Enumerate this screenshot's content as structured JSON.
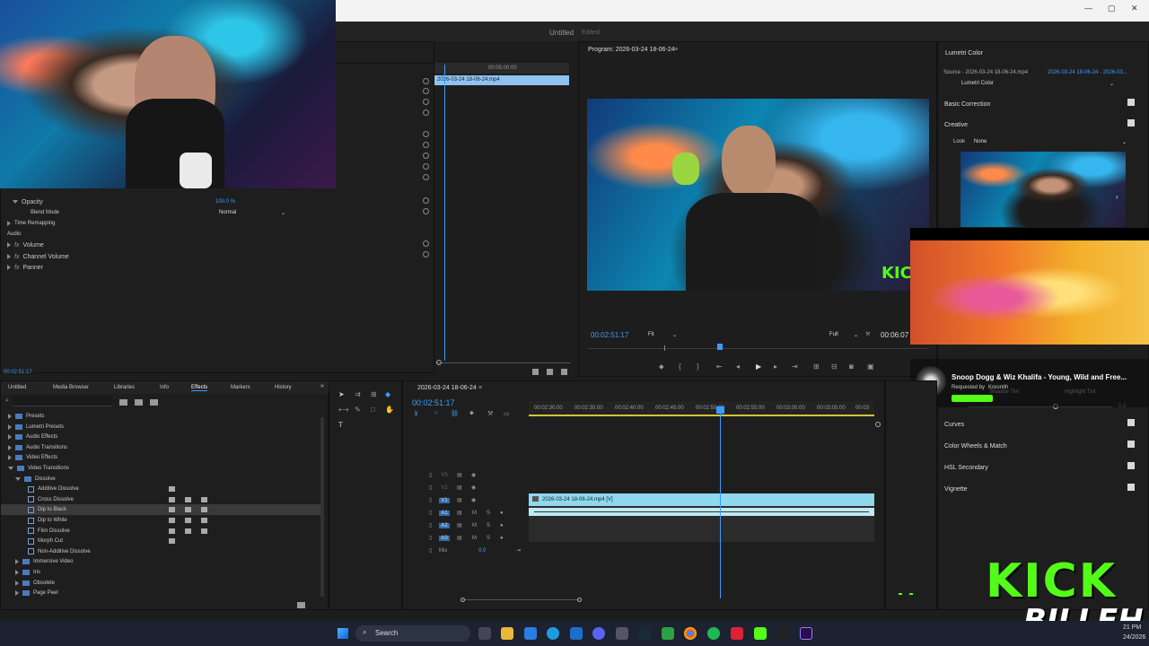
{
  "window": {
    "title": "Untitled",
    "status": "Edited"
  },
  "source_timeline": {
    "timecode": "00:05:00:00",
    "clip_name": "2026-03-24 18-06-24.mp4"
  },
  "effect_controls": {
    "rows": [
      {
        "label": "Opacity",
        "value": "100.0 %"
      },
      {
        "label": "Blend Mode",
        "value": "Normal"
      },
      {
        "label": "Time Remapping"
      },
      {
        "label": "Audio"
      },
      {
        "label": "Volume"
      },
      {
        "label": "Channel Volume"
      },
      {
        "label": "Panner"
      }
    ],
    "timecode": "00:02:51:17"
  },
  "program_monitor": {
    "title": "Program: 2026-03-24 18-06-24",
    "timecode": "00:02:51:17",
    "fit": "Fit",
    "quality": "Full",
    "duration": "00:06:07"
  },
  "lumetri": {
    "title": "Lumetri Color",
    "source": "Source - 2026-03-24 18-06-24.mp4",
    "source_link": "2026-03-24 18-06-24 - 2026-03...",
    "effect": "Lumetri Color",
    "sections": [
      "Basic Correction",
      "Creative"
    ],
    "look_label": "Look",
    "look_value": "None",
    "more_sections": [
      "Curves",
      "Color Wheels & Match",
      "HSL Secondary",
      "Vignette"
    ],
    "slider_value": "0.0"
  },
  "now_playing": {
    "song": "Snoop Dogg & Wiz Khalifa - Young, Wild and Free...",
    "requested_prefix": "Requested by",
    "requested_by": "Kreonith",
    "ghost_labels": [
      "Shadow Tint",
      "Highlight Tint"
    ]
  },
  "project_panel": {
    "tabs": [
      "Untitled",
      "Media Browser",
      "Libraries",
      "Info",
      "Effects",
      "Markers",
      "History"
    ],
    "active_tab": "Effects",
    "tree": [
      {
        "label": "Presets",
        "level": 0
      },
      {
        "label": "Lumetri Presets",
        "level": 0
      },
      {
        "label": "Audio Effects",
        "level": 0
      },
      {
        "label": "Audio Transitions",
        "level": 0
      },
      {
        "label": "Video Effects",
        "level": 0
      },
      {
        "label": "Video Transitions",
        "level": 0,
        "open": true
      },
      {
        "label": "Dissolve",
        "level": 1,
        "open": true
      },
      {
        "label": "Additive Dissolve",
        "level": 2
      },
      {
        "label": "Cross Dissolve",
        "level": 2
      },
      {
        "label": "Dip to Black",
        "level": 2,
        "selected": true
      },
      {
        "label": "Dip to White",
        "level": 2
      },
      {
        "label": "Film Dissolve",
        "level": 2
      },
      {
        "label": "Morph Cut",
        "level": 2
      },
      {
        "label": "Non-Additive Dissolve",
        "level": 2
      },
      {
        "label": "Immersive Video",
        "level": 1
      },
      {
        "label": "Iris",
        "level": 1
      },
      {
        "label": "Obsolete",
        "level": 1
      },
      {
        "label": "Page Peel",
        "level": 1
      }
    ]
  },
  "timeline": {
    "sequence": "2026-03-24 18-06-24",
    "timecode": "00:02:51:17",
    "ruler": [
      "00:02:30:00",
      "00:02:35:00",
      "00:02:40:00",
      "00:02:45:00",
      "00:02:50:00",
      "00:02:55:00",
      "00:03:00:00",
      "00:03:05:00",
      "00:03"
    ],
    "tracks": [
      "V3",
      "V2",
      "V1",
      "A1",
      "A2",
      "A3"
    ],
    "mix_label": "Mix",
    "mix_value": "0.0",
    "clip_label": "2026-03-24 18-06-24.mp4 [V]"
  },
  "overlay": {
    "brand_top": "KICK",
    "brand_bottom": "BILLEH"
  },
  "taskbar": {
    "search_placeholder": "Search",
    "time": "21 PM",
    "date": "24/2026"
  },
  "colors": {
    "accent": "#3b9cff",
    "clip": "#8fd8ee",
    "kick_green": "#53fc18"
  }
}
